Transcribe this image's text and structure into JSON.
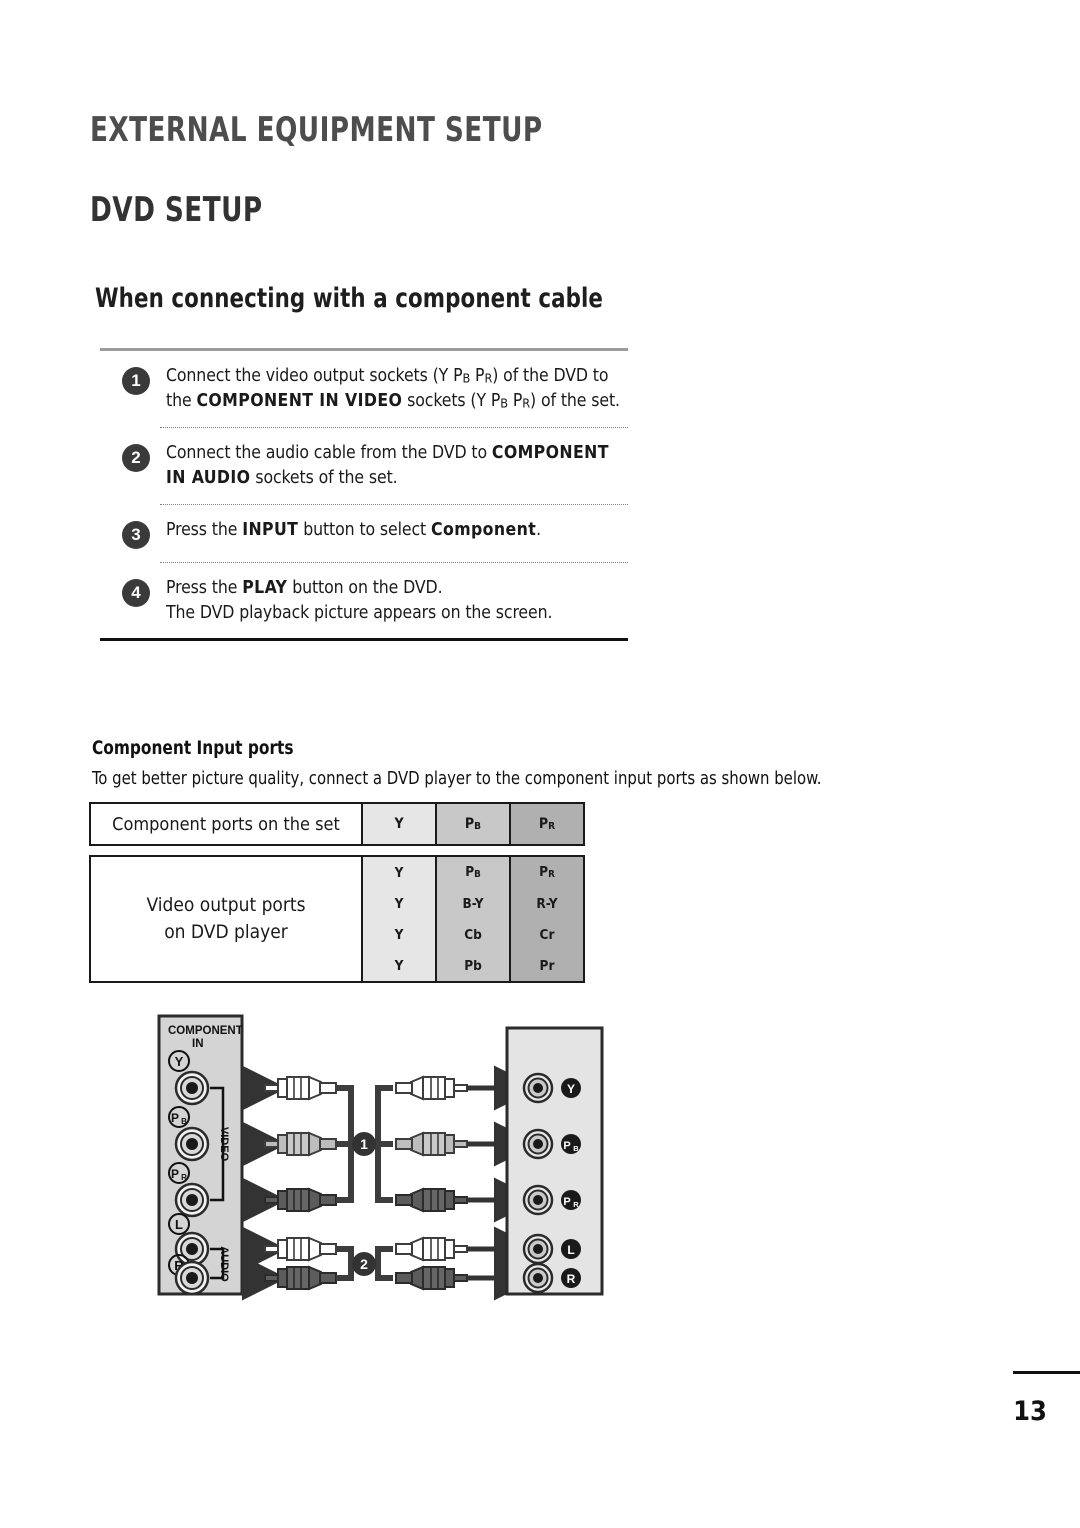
{
  "document": {
    "chapter_title": "EXTERNAL EQUIPMENT SETUP",
    "section_title": "DVD SETUP",
    "subsection_title": "When connecting with a component cable",
    "page_number": "13"
  },
  "steps": [
    {
      "number": "1",
      "text_plain": "Connect the video output sockets (Y PB PR) of the DVD to the COMPONENT IN VIDEO sockets (Y PB PR) of the set."
    },
    {
      "number": "2",
      "text_plain": "Connect the audio cable from the DVD to COMPONENT IN AUDIO sockets of the set."
    },
    {
      "number": "3",
      "text_plain": "Press the INPUT button to select Component."
    },
    {
      "number": "4",
      "text_plain": "Press the PLAY button on the DVD. The DVD playback picture appears on the screen."
    }
  ],
  "step_fragments": {
    "s1_a": "Connect the video output sockets (Y P",
    "s1_b": "B",
    "s1_c": " P",
    "s1_d": "R",
    "s1_e": ") of the DVD to ",
    "s1_f": "the ",
    "s1_g": "COMPONENT IN VIDEO",
    "s1_h": " sockets (Y P",
    "s1_i": "B",
    "s1_j": " P",
    "s1_k": "R",
    "s1_l": ") of the set.",
    "s2_a": "Connect the audio cable from the DVD to ",
    "s2_b": "COMPONENT",
    "s2_c": "IN AUDIO",
    "s2_d": " sockets of the set.",
    "s3_a": "Press the ",
    "s3_b": "INPUT",
    "s3_c": " button to select ",
    "s3_d": "Component",
    "s3_e": ".",
    "s4_a": "Press the ",
    "s4_b": "PLAY",
    "s4_c": " button on the DVD.",
    "s4_d": "The DVD playback picture appears on the screen."
  },
  "ports_section": {
    "heading": "Component Input ports",
    "description": "To get better picture quality, connect a DVD player to the component input ports as shown below."
  },
  "table_set": {
    "row_label": "Component ports on the set",
    "columns": [
      "Y",
      "PB",
      "PR"
    ],
    "column_parts": [
      {
        "main": "Y",
        "sub": ""
      },
      {
        "main": "P",
        "sub": "B"
      },
      {
        "main": "P",
        "sub": "R"
      }
    ]
  },
  "table_dvd": {
    "row_label_line1": "Video output ports",
    "row_label_line2": "on DVD player",
    "rows": [
      {
        "y": "Y",
        "pb_main": "P",
        "pb_sub": "B",
        "pr_main": "P",
        "pr_sub": "R"
      },
      {
        "y": "Y",
        "pb_main": "B-Y",
        "pb_sub": "",
        "pr_main": "R-Y",
        "pr_sub": ""
      },
      {
        "y": "Y",
        "pb_main": "Cb",
        "pb_sub": "",
        "pr_main": "Cr",
        "pr_sub": ""
      },
      {
        "y": "Y",
        "pb_main": "Pb",
        "pb_sub": "",
        "pr_main": "Pr",
        "pr_sub": ""
      }
    ]
  },
  "diagram": {
    "tv_panel": {
      "title_line1": "COMPONENT",
      "title_line2": "IN",
      "group_video": "VIDEO",
      "group_audio": "AUDIO",
      "jacks": [
        {
          "label_main": "Y",
          "label_sub": "",
          "group": "video",
          "plug_color": "white"
        },
        {
          "label_main": "P",
          "label_sub": "B",
          "group": "video",
          "plug_color": "light-gray"
        },
        {
          "label_main": "P",
          "label_sub": "R",
          "group": "video",
          "plug_color": "dark-gray"
        },
        {
          "label_main": "L",
          "label_sub": "",
          "group": "audio",
          "plug_color": "white"
        },
        {
          "label_main": "R",
          "label_sub": "",
          "group": "audio",
          "plug_color": "dark-gray"
        }
      ]
    },
    "dvd_panel": {
      "jacks": [
        {
          "label_main": "Y",
          "label_sub": "",
          "plug_color": "white"
        },
        {
          "label_main": "P",
          "label_sub": "B",
          "plug_color": "light-gray"
        },
        {
          "label_main": "P",
          "label_sub": "R",
          "plug_color": "dark-gray"
        },
        {
          "label_main": "L",
          "label_sub": "",
          "plug_color": "white"
        },
        {
          "label_main": "R",
          "label_sub": "",
          "plug_color": "dark-gray"
        }
      ]
    },
    "cable_badges": [
      {
        "number": "1",
        "connects": "video"
      },
      {
        "number": "2",
        "connects": "audio"
      }
    ]
  },
  "colors": {
    "panel_gray": "#d4d4d4",
    "dvd_panel_gray": "#e2e2e2",
    "cable_dark": "#404040",
    "badge_dark": "#3a3a3a",
    "cell_y": "#e6e6e6",
    "cell_pb": "#c8c8c8",
    "cell_pr": "#b0b0b0",
    "rule_gray": "#9b9b9b",
    "rule_black": "#111111"
  }
}
